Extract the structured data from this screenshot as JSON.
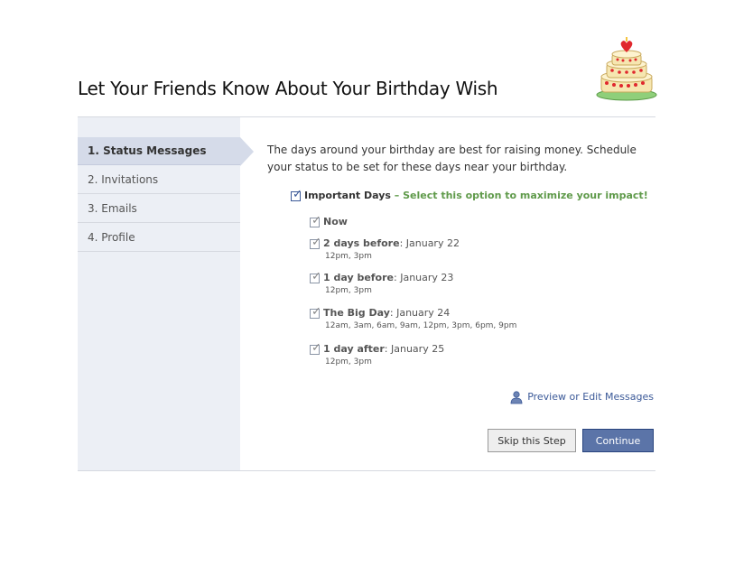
{
  "header": {
    "title": "Let Your Friends Know About Your Birthday Wish"
  },
  "sidebar": {
    "items": [
      {
        "label": "1. Status Messages",
        "active": true
      },
      {
        "label": "2. Invitations",
        "active": false
      },
      {
        "label": "3. Emails",
        "active": false
      },
      {
        "label": "4. Profile",
        "active": false
      }
    ]
  },
  "main": {
    "intro": "The days around your birthday are best for raising money. Schedule your status to be set for these days near your birthday.",
    "important_days": {
      "label": "Important Days",
      "hint": " – Select this option to maximize your impact!",
      "checked": true
    },
    "schedule": [
      {
        "label": "Now",
        "date": "",
        "times": "",
        "checked": true
      },
      {
        "label": "2 days before",
        "date": ": January 22",
        "times": "12pm, 3pm",
        "checked": true
      },
      {
        "label": "1 day before",
        "date": ": January 23",
        "times": "12pm, 3pm",
        "checked": true
      },
      {
        "label": "The Big Day",
        "date": ": January 24",
        "times": "12am, 3am, 6am, 9am, 12pm, 3pm, 6pm, 9pm",
        "checked": true
      },
      {
        "label": "1 day after",
        "date": ": January 25",
        "times": "12pm, 3pm",
        "checked": true
      }
    ],
    "preview_link": "Preview or Edit Messages",
    "buttons": {
      "skip": "Skip this Step",
      "continue": "Continue"
    }
  },
  "colors": {
    "brand": "#3b5998",
    "hint_green": "#5f9a4a",
    "sidebar_bg": "#eceff5",
    "active_step": "#d5dbe9"
  },
  "icons": {
    "header_image": "birthday-cake-icon",
    "preview": "person-icon",
    "check": "checkmark-icon"
  }
}
